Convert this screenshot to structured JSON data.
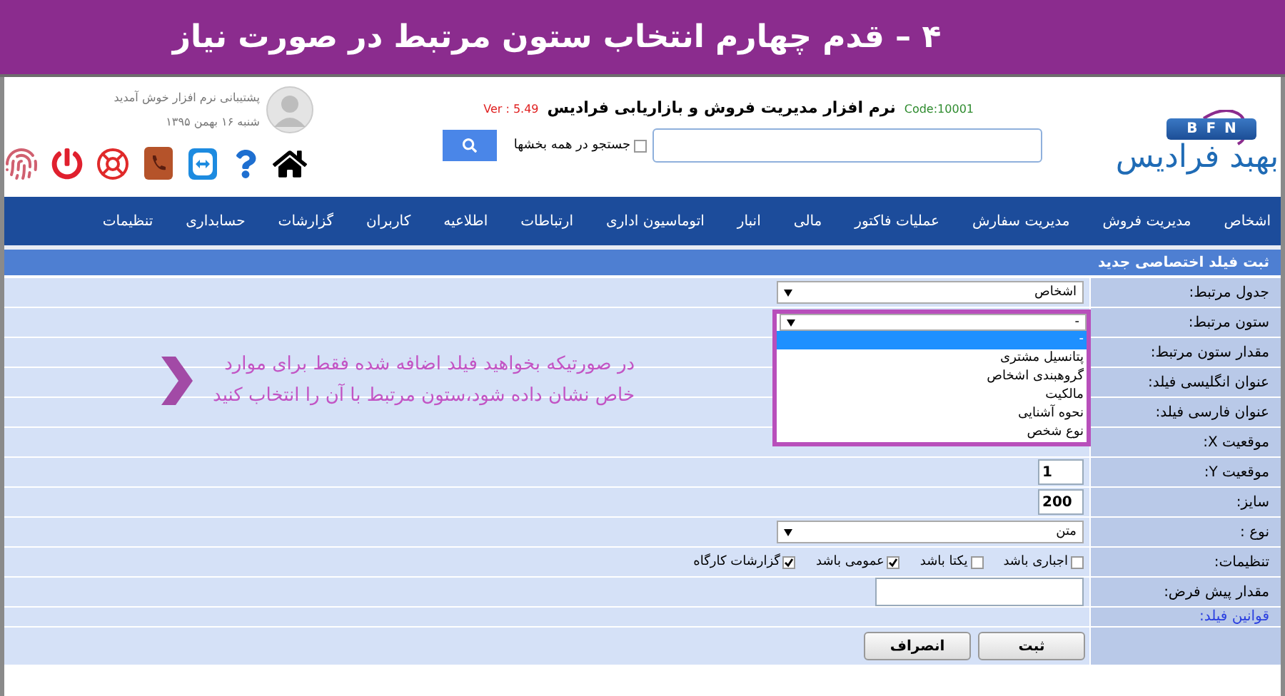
{
  "banner": {
    "title": "۴ – قدم چهارم انتخاب ستون مرتبط در صورت نیاز"
  },
  "header": {
    "logo": {
      "badge": "BFN",
      "name": "بهبد فرادیس"
    },
    "app_title": "نرم افزار مدیریت فروش و بازاریابی فرادیس",
    "code": "Code:10001",
    "version": "Ver : 5.49",
    "search": {
      "all_sections": {
        "label": "جستجو در همه بخشها",
        "checked": false
      }
    },
    "user": {
      "greeting": "پشتیبانی نرم افزار خوش آمدید",
      "date": "شنبه ۱۶ بهمن ۱۳۹۵"
    }
  },
  "nav": [
    "اشخاص",
    "مدیریت فروش",
    "مدیریت سفارش",
    "عملیات فاکتور",
    "مالی",
    "انبار",
    "اتوماسیون اداری",
    "ارتباطات",
    "اطلاعیه",
    "کاربران",
    "گزارشات",
    "حسابداری",
    "تنظیمات"
  ],
  "form": {
    "title": "ثبت فیلد اختصاصی جدید",
    "rows": [
      {
        "label": "جدول مرتبط:",
        "kind": "select",
        "value": "اشخاص"
      },
      {
        "label": "ستون مرتبط:",
        "kind": "select",
        "value": "-",
        "expanded": true,
        "options": [
          {
            "label": "-",
            "selected": true
          },
          {
            "label": "پتانسیل مشتری",
            "selected": false
          },
          {
            "label": "گروهبندی اشخاص",
            "selected": false
          },
          {
            "label": "مالکیت",
            "selected": false
          },
          {
            "label": "نحوه آشنایی",
            "selected": false
          },
          {
            "label": "نوع شخص",
            "selected": false
          }
        ]
      },
      {
        "label": "مقدار ستون مرتبط:",
        "kind": "none"
      },
      {
        "label": "عنوان انگلیسی فیلد:",
        "kind": "none"
      },
      {
        "label": "عنوان فارسی فیلد:",
        "kind": "none"
      },
      {
        "label": "موقعیت X:",
        "kind": "none"
      },
      {
        "label": "موقعیت Y:",
        "kind": "number",
        "value": "1"
      },
      {
        "label": "سایز:",
        "kind": "number",
        "value": "200"
      },
      {
        "label": "نوع :",
        "kind": "select",
        "value": "متن"
      },
      {
        "label": "تنظیمات:",
        "kind": "checks",
        "checks": [
          {
            "label": "اجباری باشد",
            "checked": false
          },
          {
            "label": "یکتا باشد",
            "checked": false
          },
          {
            "label": "عمومی باشد",
            "checked": true
          },
          {
            "label": "گزارشات کارگاه",
            "checked": true
          }
        ]
      },
      {
        "label": "مقدار پیش فرض:",
        "kind": "text"
      },
      {
        "label": "قوانین فیلد:",
        "kind": "link"
      }
    ],
    "buttons": [
      "ثبت",
      "انصراف"
    ]
  },
  "annotation": {
    "lines": [
      "در صورتیکه بخواهید فیلد اضافه شده فقط برای موارد",
      "خاص نشان داده شود،ستون مرتبط با آن را انتخاب کنید"
    ]
  }
}
